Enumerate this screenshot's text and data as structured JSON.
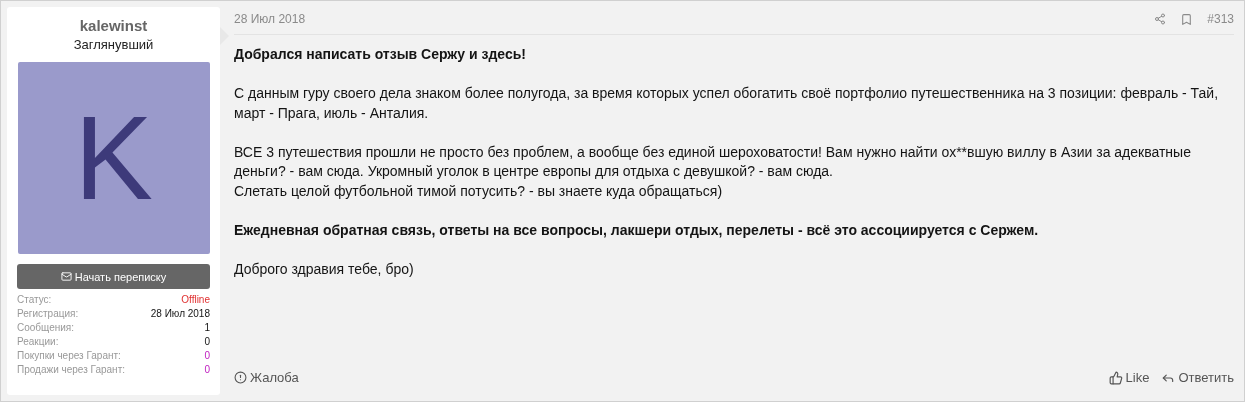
{
  "user": {
    "name": "kalewinst",
    "title": "Заглянувший",
    "avatar_letter": "K",
    "message_button": "Начать переписку",
    "stats": [
      {
        "label": "Статус:",
        "value": "Offline",
        "kind": "status"
      },
      {
        "label": "Регистрация:",
        "value": "28 Июл 2018",
        "kind": "plain"
      },
      {
        "label": "Сообщения:",
        "value": "1",
        "kind": "plain"
      },
      {
        "label": "Реакции:",
        "value": "0",
        "kind": "plain"
      },
      {
        "label": "Покупки через Гарант:",
        "value": "0",
        "kind": "guarantee"
      },
      {
        "label": "Продажи через Гарант:",
        "value": "0",
        "kind": "guarantee"
      }
    ]
  },
  "post": {
    "date": "28 Июл 2018",
    "number": "#313",
    "paragraphs": [
      {
        "bold": true,
        "lines": [
          "Добрался написать отзыв Сержу и здесь!"
        ]
      },
      {
        "bold": false,
        "lines": [
          "С данным гуру своего дела знаком более полугода, за время которых успел обогатить своё портфолио путешественника на 3 позиции: февраль - Тай, март - Прага, июль - Анталия."
        ]
      },
      {
        "bold": false,
        "lines": [
          "ВСЕ 3 путешествия прошли не просто без проблем, а вообще без единой шероховатости! Вам нужно найти ох**вшую виллу в Азии за адекватные деньги? - вам сюда. Укромный уголок в центре европы для отдыха с девушкой? - вам сюда.",
          "Слетать целой футбольной тимой потусить? - вы знаете куда обращаться)"
        ]
      },
      {
        "bold": true,
        "lines": [
          "Ежедневная обратная связь, ответы на все вопросы, лакшери отдых, перелеты - всё это ассоциируется с Сержем."
        ]
      },
      {
        "bold": false,
        "lines": [
          "Доброго здравия тебе, бро)"
        ]
      }
    ],
    "report": "Жалоба",
    "like": "Like",
    "reply": "Ответить"
  }
}
